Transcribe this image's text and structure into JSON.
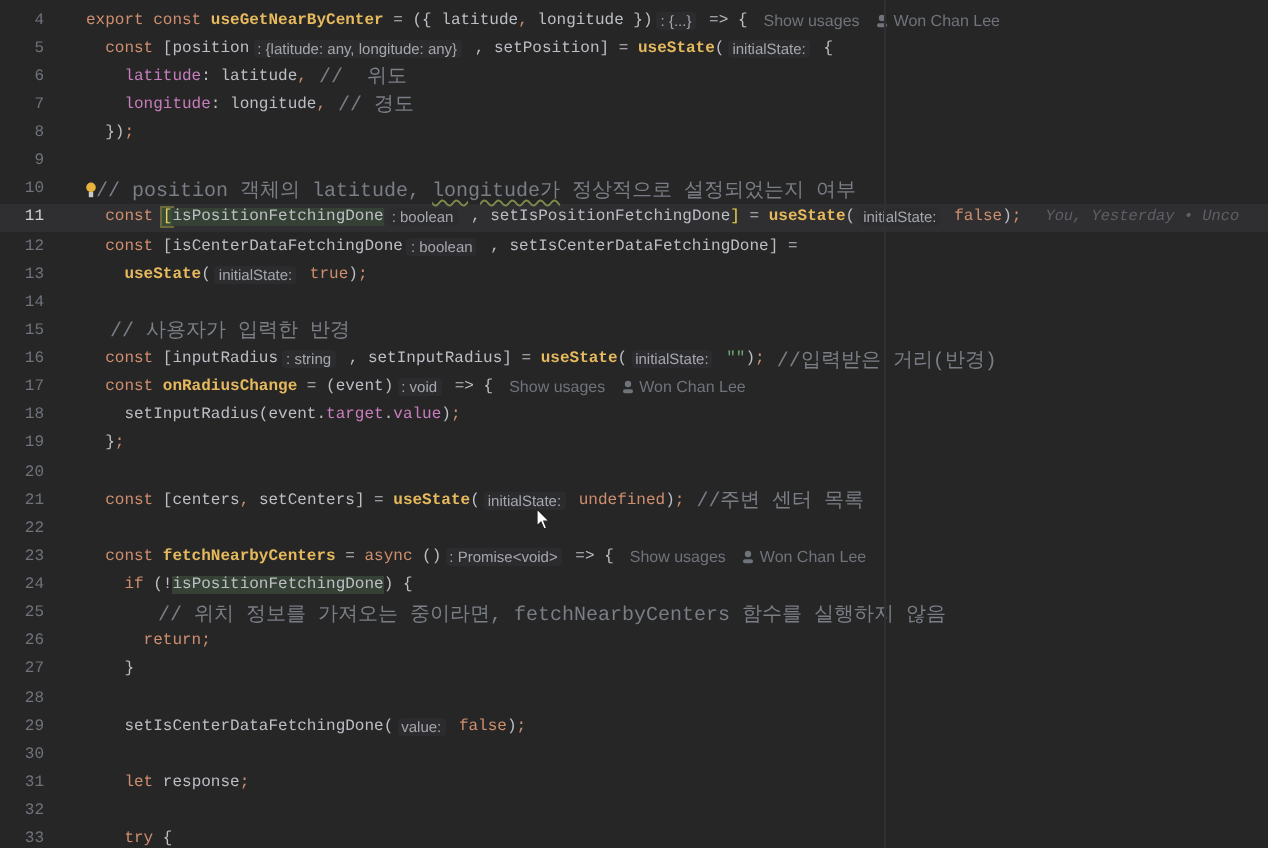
{
  "editor": {
    "lines": [
      {
        "number": "4",
        "current": false,
        "tokens": [
          {
            "kind": "kw",
            "text": "export const "
          },
          {
            "kind": "fn",
            "text": "useGetNearByCenter"
          },
          {
            "kind": "plain",
            "text": " = ({ latitude"
          },
          {
            "kind": "punct",
            "text": ","
          },
          {
            "kind": "plain",
            "text": " longitude })"
          },
          {
            "kind": "hint",
            "text": ": {...}"
          },
          {
            "kind": "plain",
            "text": " => {"
          },
          {
            "kind": "usage",
            "text": "Show usages"
          },
          {
            "kind": "author",
            "text": "Won Chan Lee"
          }
        ]
      },
      {
        "number": "5",
        "current": false,
        "tokens": [
          {
            "kind": "kw",
            "text": "  const"
          },
          {
            "kind": "plain",
            "text": " [position"
          },
          {
            "kind": "hint",
            "text": ": {latitude: any, longitude: any}"
          },
          {
            "kind": "plain",
            "text": " , setPosition] = "
          },
          {
            "kind": "fn",
            "text": "useState"
          },
          {
            "kind": "plain",
            "text": "("
          },
          {
            "kind": "hint",
            "text": "initialState:"
          },
          {
            "kind": "plain",
            "text": " {"
          }
        ]
      },
      {
        "number": "6",
        "current": false,
        "tokens": [
          {
            "kind": "prop",
            "text": "    latitude"
          },
          {
            "kind": "plain",
            "text": ": latitude"
          },
          {
            "kind": "punct",
            "text": ","
          },
          {
            "kind": "comment",
            "text": " //  위도"
          }
        ]
      },
      {
        "number": "7",
        "current": false,
        "tokens": [
          {
            "kind": "prop",
            "text": "    longitude"
          },
          {
            "kind": "plain",
            "text": ": longitude"
          },
          {
            "kind": "punct",
            "text": ","
          },
          {
            "kind": "comment",
            "text": " // 경도"
          }
        ]
      },
      {
        "number": "8",
        "current": false,
        "tokens": [
          {
            "kind": "plain",
            "text": "  })"
          },
          {
            "kind": "punct",
            "text": ";"
          }
        ]
      },
      {
        "number": "9",
        "current": false
      },
      {
        "number": "10",
        "current": false,
        "tokens": [
          {
            "kind": "bulb"
          },
          {
            "kind": "comment",
            "text": "// position 객체의 latitude, "
          },
          {
            "kind": "typo",
            "text": "longitude가"
          },
          {
            "kind": "comment",
            "text": " 정상적으로 설정되었는지 여부"
          }
        ]
      },
      {
        "number": "11",
        "current": true,
        "tokens": [
          {
            "kind": "kw",
            "text": "  const "
          },
          {
            "kind": "bracket",
            "text": "["
          },
          {
            "kind": "ident",
            "text": "isPositionFetchingDone"
          },
          {
            "kind": "hint",
            "text": ": boolean"
          },
          {
            "kind": "plain",
            "text": " , setIsPositionFetchingDone"
          },
          {
            "kind": "bracket2",
            "text": "]"
          },
          {
            "kind": "plain",
            "text": " = "
          },
          {
            "kind": "fn",
            "text": "useState"
          },
          {
            "kind": "plain",
            "text": "("
          },
          {
            "kind": "hint",
            "text": "initialState:"
          },
          {
            "kind": "kw",
            "text": " false"
          },
          {
            "kind": "plain",
            "text": ")"
          },
          {
            "kind": "punct",
            "text": ";"
          },
          {
            "kind": "blame",
            "text": "You, Yesterday • Unco"
          }
        ]
      },
      {
        "number": "12",
        "current": false,
        "tokens": [
          {
            "kind": "kw",
            "text": "  const"
          },
          {
            "kind": "plain",
            "text": " [isCenterDataFetchingDone"
          },
          {
            "kind": "hint",
            "text": ": boolean"
          },
          {
            "kind": "plain",
            "text": " , setIsCenterDataFetchingDone] ="
          }
        ]
      },
      {
        "number": "13",
        "current": false,
        "tokens": [
          {
            "kind": "fn",
            "text": "    useState"
          },
          {
            "kind": "plain",
            "text": "("
          },
          {
            "kind": "hint",
            "text": "initialState:"
          },
          {
            "kind": "kw",
            "text": " true"
          },
          {
            "kind": "plain",
            "text": ")"
          },
          {
            "kind": "punct",
            "text": ";"
          }
        ]
      },
      {
        "number": "14",
        "current": false
      },
      {
        "number": "15",
        "current": false,
        "tokens": [
          {
            "kind": "comment",
            "text": "  // 사용자가 입력한 반경"
          }
        ]
      },
      {
        "number": "16",
        "current": false,
        "tokens": [
          {
            "kind": "kw",
            "text": "  const"
          },
          {
            "kind": "plain",
            "text": " [inputRadius"
          },
          {
            "kind": "hint",
            "text": ": string"
          },
          {
            "kind": "plain",
            "text": " , setInputRadius] = "
          },
          {
            "kind": "fn",
            "text": "useState"
          },
          {
            "kind": "plain",
            "text": "("
          },
          {
            "kind": "hint",
            "text": "initialState:"
          },
          {
            "kind": "str",
            "text": " \"\""
          },
          {
            "kind": "plain",
            "text": ")"
          },
          {
            "kind": "punct",
            "text": ";"
          },
          {
            "kind": "comment",
            "text": " //입력받은 거리(반경)"
          }
        ]
      },
      {
        "number": "17",
        "current": false,
        "tokens": [
          {
            "kind": "kw",
            "text": "  const "
          },
          {
            "kind": "fn",
            "text": "onRadiusChange"
          },
          {
            "kind": "plain",
            "text": " = (event)"
          },
          {
            "kind": "hint",
            "text": ": void"
          },
          {
            "kind": "plain",
            "text": " => {"
          },
          {
            "kind": "usage",
            "text": "Show usages"
          },
          {
            "kind": "author",
            "text": "Won Chan Lee"
          }
        ]
      },
      {
        "number": "18",
        "current": false,
        "tokens": [
          {
            "kind": "plain",
            "text": "    setInputRadius(event."
          },
          {
            "kind": "prop",
            "text": "target"
          },
          {
            "kind": "plain",
            "text": "."
          },
          {
            "kind": "prop",
            "text": "value"
          },
          {
            "kind": "plain",
            "text": ")"
          },
          {
            "kind": "punct",
            "text": ";"
          }
        ]
      },
      {
        "number": "19",
        "current": false,
        "tokens": [
          {
            "kind": "plain",
            "text": "  }"
          },
          {
            "kind": "punct",
            "text": ";"
          }
        ]
      },
      {
        "number": "20",
        "current": false
      },
      {
        "number": "21",
        "current": false,
        "tokens": [
          {
            "kind": "kw",
            "text": "  const"
          },
          {
            "kind": "plain",
            "text": " [centers"
          },
          {
            "kind": "punct",
            "text": ","
          },
          {
            "kind": "plain",
            "text": " setCenters] = "
          },
          {
            "kind": "fn",
            "text": "useState"
          },
          {
            "kind": "plain",
            "text": "("
          },
          {
            "kind": "hint",
            "text": "initialState:"
          },
          {
            "kind": "kw",
            "text": " undefined"
          },
          {
            "kind": "plain",
            "text": ")"
          },
          {
            "kind": "punct",
            "text": ";"
          },
          {
            "kind": "comment",
            "text": " //주변 센터 목록"
          }
        ]
      },
      {
        "number": "22",
        "current": false
      },
      {
        "number": "23",
        "current": false,
        "tokens": [
          {
            "kind": "kw",
            "text": "  const "
          },
          {
            "kind": "fn",
            "text": "fetchNearbyCenters"
          },
          {
            "kind": "plain",
            "text": " = "
          },
          {
            "kind": "kw",
            "text": "async"
          },
          {
            "kind": "plain",
            "text": " ()"
          },
          {
            "kind": "hint",
            "text": ": Promise<void>"
          },
          {
            "kind": "plain",
            "text": " => {"
          },
          {
            "kind": "usage",
            "text": "Show usages"
          },
          {
            "kind": "author",
            "text": "Won Chan Lee"
          }
        ]
      },
      {
        "number": "24",
        "current": false,
        "tokens": [
          {
            "kind": "kw",
            "text": "    if"
          },
          {
            "kind": "plain",
            "text": " (!"
          },
          {
            "kind": "ident",
            "text": "isPositionFetchingDone"
          },
          {
            "kind": "plain",
            "text": ") {"
          }
        ]
      },
      {
        "number": "25",
        "current": false,
        "tokens": [
          {
            "kind": "comment",
            "text": "      // 위치 정보를 가져오는 중이라면, fetchNearbyCenters 함수를 실행하지 않음"
          }
        ]
      },
      {
        "number": "26",
        "current": false,
        "tokens": [
          {
            "kind": "kw",
            "text": "      return"
          },
          {
            "kind": "punct",
            "text": ";"
          }
        ]
      },
      {
        "number": "27",
        "current": false,
        "tokens": [
          {
            "kind": "plain",
            "text": "    }"
          }
        ]
      },
      {
        "number": "28",
        "current": false
      },
      {
        "number": "29",
        "current": false,
        "tokens": [
          {
            "kind": "plain",
            "text": "    setIsCenterDataFetchingDone("
          },
          {
            "kind": "hint",
            "text": "value:"
          },
          {
            "kind": "kw",
            "text": " false"
          },
          {
            "kind": "plain",
            "text": ")"
          },
          {
            "kind": "punct",
            "text": ";"
          }
        ]
      },
      {
        "number": "30",
        "current": false
      },
      {
        "number": "31",
        "current": false,
        "tokens": [
          {
            "kind": "kw",
            "text": "    let"
          },
          {
            "kind": "plain",
            "text": " response"
          },
          {
            "kind": "punct",
            "text": ";"
          }
        ]
      },
      {
        "number": "32",
        "current": false
      },
      {
        "number": "33",
        "current": false,
        "tokens": [
          {
            "kind": "kw",
            "text": "    try"
          },
          {
            "kind": "plain",
            "text": " {"
          }
        ]
      }
    ]
  }
}
